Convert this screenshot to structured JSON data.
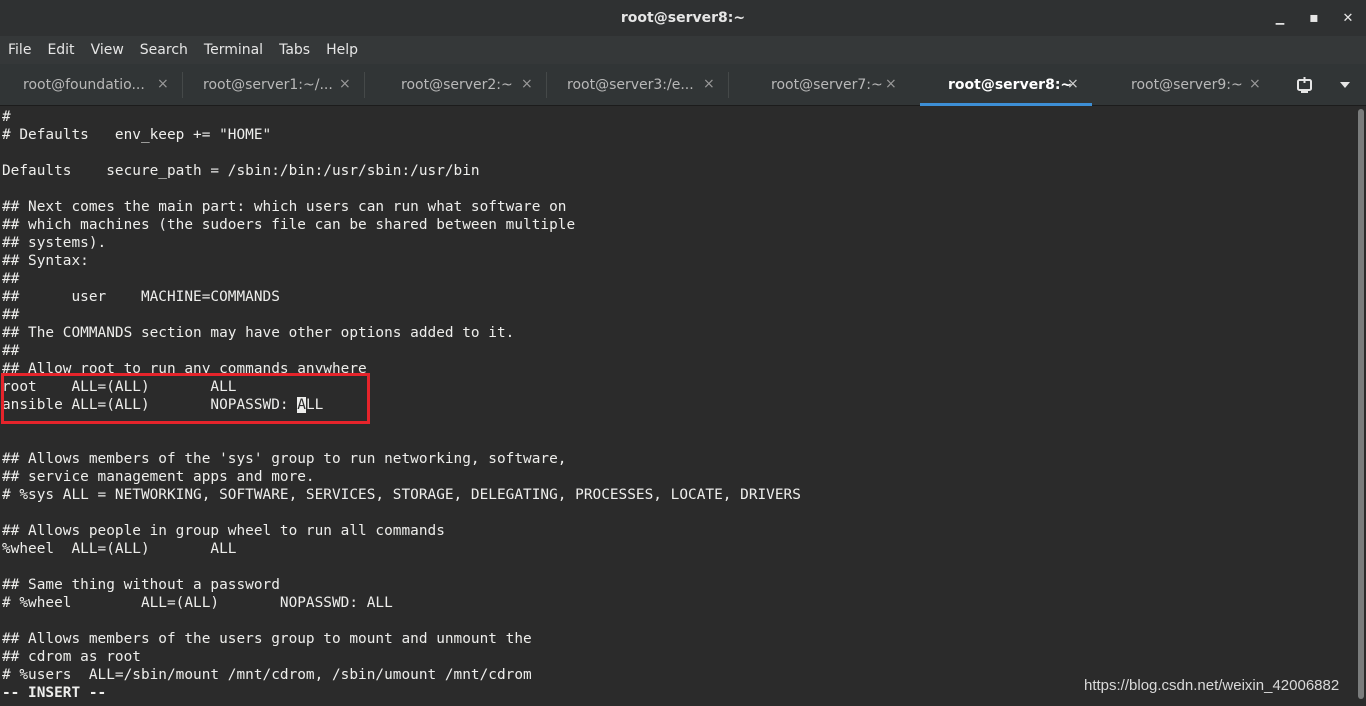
{
  "window": {
    "title": "root@server8:~",
    "minimize_symbol": "▁",
    "maximize_symbol": "▪",
    "close_symbol": "✕"
  },
  "menubar": {
    "items": [
      "File",
      "Edit",
      "View",
      "Search",
      "Terminal",
      "Tabs",
      "Help"
    ]
  },
  "tabs": [
    {
      "label": "root@foundatio...",
      "active": false
    },
    {
      "label": "root@server1:~/...",
      "active": false
    },
    {
      "label": "root@server2:~",
      "active": false
    },
    {
      "label": "root@server3:/e...",
      "active": false
    },
    {
      "label": "root@server7:~",
      "active": false
    },
    {
      "label": "root@server8:~",
      "active": true
    },
    {
      "label": "root@server9:~",
      "active": false
    }
  ],
  "tab_close_symbol": "×",
  "tabbar_icons": {
    "new_tab": "new-tab-icon",
    "dropdown": "chevron-down-icon"
  },
  "terminal": {
    "lines": [
      "#",
      "# Defaults   env_keep += \"HOME\"",
      "",
      "Defaults    secure_path = /sbin:/bin:/usr/sbin:/usr/bin",
      "",
      "## Next comes the main part: which users can run what software on",
      "## which machines (the sudoers file can be shared between multiple",
      "## systems).",
      "## Syntax:",
      "##",
      "##      user    MACHINE=COMMANDS",
      "##",
      "## The COMMANDS section may have other options added to it.",
      "##",
      "## Allow root to run any commands anywhere",
      "root    ALL=(ALL)       ALL",
      "ansible ALL=(ALL)       NOPASSWD: ALL",
      "",
      "",
      "## Allows members of the 'sys' group to run networking, software,",
      "## service management apps and more.",
      "# %sys ALL = NETWORKING, SOFTWARE, SERVICES, STORAGE, DELEGATING, PROCESSES, LOCATE, DRIVERS",
      "",
      "## Allows people in group wheel to run all commands",
      "%wheel  ALL=(ALL)       ALL",
      "",
      "## Same thing without a password",
      "# %wheel        ALL=(ALL)       NOPASSWD: ALL",
      "",
      "## Allows members of the users group to mount and unmount the",
      "## cdrom as root",
      "# %users  ALL=/sbin/mount /mnt/cdrom, /sbin/umount /mnt/cdrom",
      "-- INSERT --"
    ],
    "cursor_line": 16,
    "cursor_column": 34,
    "highlight_lines": [
      15,
      16
    ],
    "highlight_color": "#e6242b"
  },
  "watermark": "https://blog.csdn.net/weixin_42006882"
}
